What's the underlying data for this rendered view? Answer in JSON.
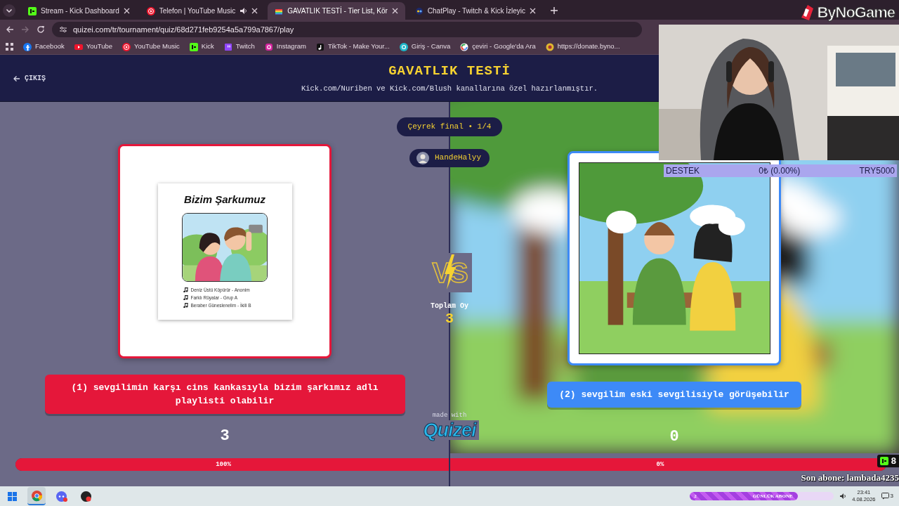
{
  "browser": {
    "tabs": [
      {
        "title": "Stream - Kick Dashboard",
        "kind": "kick",
        "selected": false,
        "audio": false
      },
      {
        "title": "Telefon | YouTube Music",
        "kind": "ytmusic",
        "selected": false,
        "audio": true
      },
      {
        "title": "GAVATLIK TESTİ - Tier List, Kör",
        "kind": "rainbow",
        "selected": true,
        "audio": false
      },
      {
        "title": "ChatPlay - Twitch & Kick İzleyic",
        "kind": "chatplay",
        "selected": false,
        "audio": false
      }
    ],
    "address": "quizei.com/tr/tournament/quiz/68d271feb9254a5a799a7867/play",
    "bookmarks": [
      {
        "label": "Facebook",
        "kind": "facebook"
      },
      {
        "label": "YouTube",
        "kind": "youtube"
      },
      {
        "label": "YouTube Music",
        "kind": "ytmusic"
      },
      {
        "label": "Kick",
        "kind": "kick"
      },
      {
        "label": "Twitch",
        "kind": "twitch"
      },
      {
        "label": "Instagram",
        "kind": "instagram"
      },
      {
        "label": "TikTok - Make Your...",
        "kind": "tiktok"
      },
      {
        "label": "Giriş - Canva",
        "kind": "canva"
      },
      {
        "label": "çeviri - Google'da Ara",
        "kind": "google"
      },
      {
        "label": "https://donate.byno...",
        "kind": "donate"
      }
    ]
  },
  "quiz": {
    "exit": "ÇIKIŞ",
    "title": "GAVATLIK TESTİ",
    "subtitle": "Kick.com/Nuriben ve Kick.com/Blush kanallarına özel hazırlanmıştır.",
    "round": "Çeyrek final • 1/4",
    "player": "HandeHalyy",
    "vs": "VS",
    "total_label": "Toplam Oy",
    "total": "3",
    "made_with": "made with",
    "brand": "Quizei",
    "options": [
      {
        "label": "(1) sevgilimin karşı cins kankasıyla bizim şarkımız adlı playlisti olabilir",
        "color": "#e5173a",
        "votes": "3",
        "percent": "100%",
        "image": {
          "kind": "playlist",
          "title": "Bizim Şarkumuz",
          "songs": [
            "Deniz Üstü Köpürür - Anonim",
            "Farklı Rüyalar - Grup A",
            "Beraber Güneslenelim - İkili B"
          ]
        }
      },
      {
        "label": "(2) sevgilim eski sevgilisiyle görüşebilir",
        "color": "#3d8af7",
        "votes": "0",
        "percent": "0%"
      }
    ],
    "vote_bar": {
      "level": 1
    }
  },
  "overlay": {
    "logo": "ByNoGame",
    "support": {
      "label": "DESTEK",
      "amount": "0₺ (0.00%)",
      "goal": "TRY5000"
    },
    "viewers": "8",
    "last_sub": "Son abone: lambada4235"
  },
  "taskbar": {
    "apps": [
      {
        "kind": "windows",
        "selected": false
      },
      {
        "kind": "chrome",
        "selected": true
      },
      {
        "kind": "discord",
        "selected": false
      },
      {
        "kind": "recorder",
        "selected": false
      }
    ],
    "sub_goal": {
      "label": "GÜNLÜK ABONE",
      "count": "2",
      "level": 0.75
    },
    "time": "23:41",
    "date": "4.08.2026",
    "notifications": "3"
  }
}
